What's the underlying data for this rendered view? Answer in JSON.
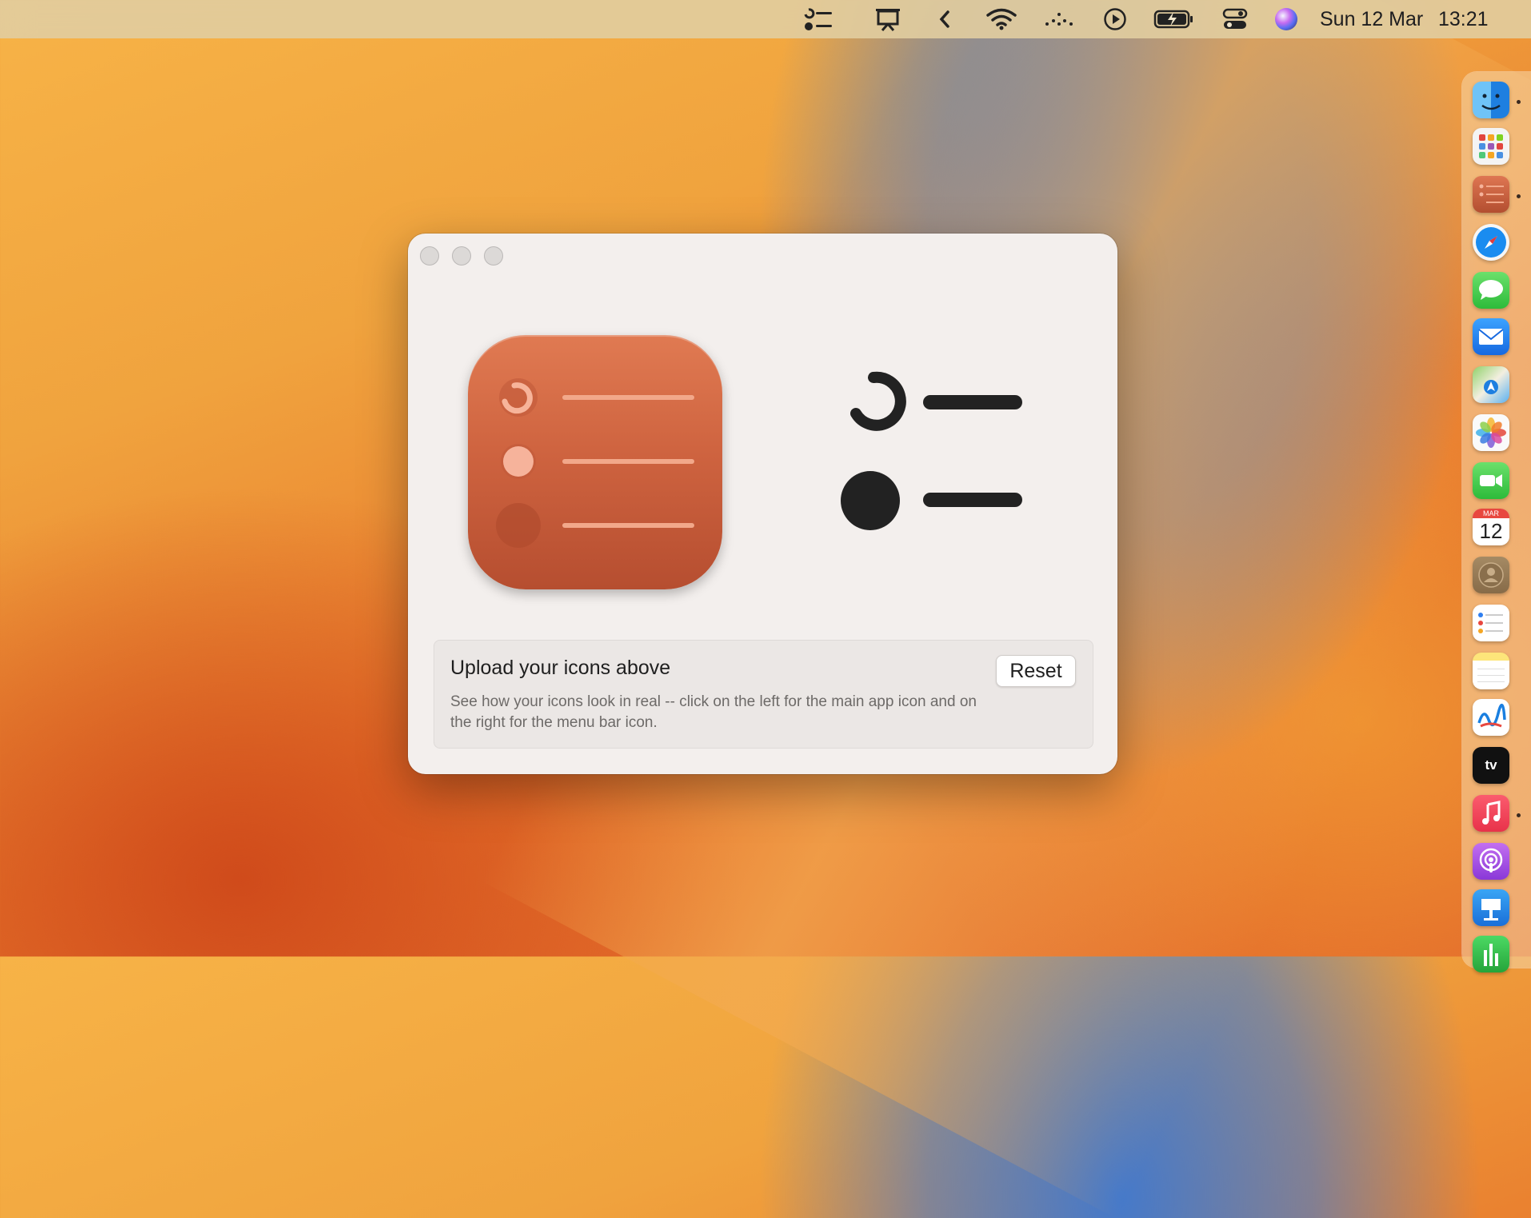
{
  "menubar": {
    "date": "Sun 12 Mar",
    "time": "13:21",
    "icons": [
      "reminders-menubar-icon",
      "presentation-icon",
      "chevron-left-icon",
      "wifi-icon",
      "dots-icon",
      "play-circle-icon",
      "battery-charging-icon",
      "control-center-icon",
      "siri-icon"
    ]
  },
  "window": {
    "info": {
      "title": "Upload your icons above",
      "description": "See how your icons look in real -- click on the left for the main app icon and on the right for the menu bar icon.",
      "reset_label": "Reset"
    }
  },
  "dock": {
    "apps": [
      "Finder",
      "Launchpad",
      "Reminders Icon App",
      "Safari",
      "Messages",
      "Mail",
      "Maps",
      "Photos",
      "FaceTime",
      "Calendar",
      "Contacts",
      "Reminders",
      "Notes",
      "Freeform",
      "TV",
      "Music",
      "Podcasts",
      "Keynote",
      "Numbers"
    ],
    "calendar": {
      "month": "MAR",
      "day": "12"
    },
    "tv_label": "tv"
  }
}
